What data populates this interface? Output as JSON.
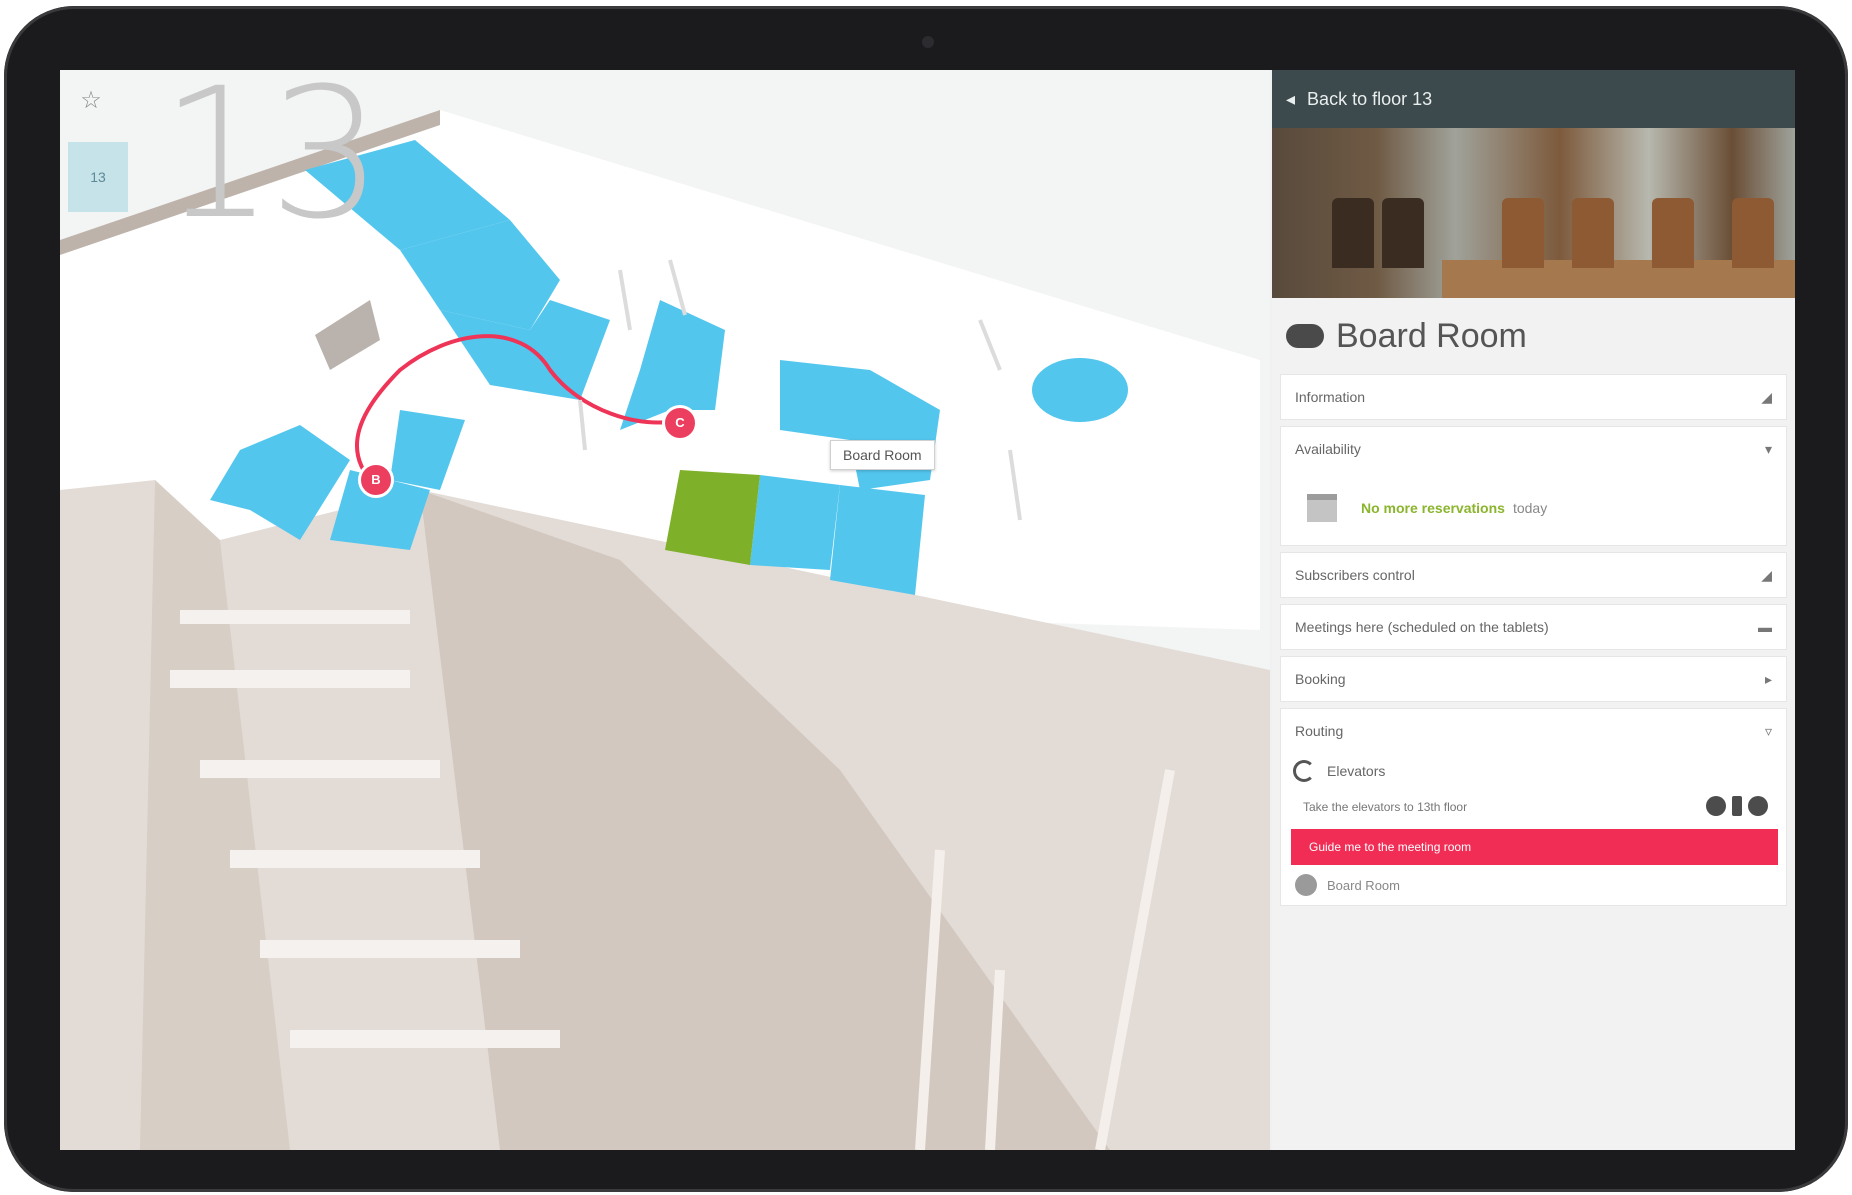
{
  "map": {
    "floor_number": "13",
    "level_button": "13",
    "tooltip": "Board Room",
    "route_start_pin": "B",
    "route_end_pin": "C"
  },
  "panel": {
    "header_back_label": "Back to floor 13",
    "room_name": "Board Room",
    "sections": {
      "information": "Information",
      "availability": "Availability",
      "availability_status": "No more reservations",
      "availability_when": "today",
      "subscribers": "Subscribers control",
      "meetings": "Meetings here (scheduled on the tablets)",
      "booking": "Booking",
      "routing": "Routing"
    },
    "routing": {
      "start_label": "Elevators",
      "transport_label": "Take the elevators to 13th floor",
      "go_button": "Guide me to the meeting room",
      "destination": "Board Room"
    }
  },
  "colors": {
    "accent": "#f12d55",
    "room_highlight": "#7fb02a",
    "rooms": "#4fc3ec",
    "header_bg": "#3c4a4d"
  },
  "icons": [
    "star-icon",
    "back-arrow-icon",
    "cloud-icon",
    "calendar-icon",
    "elevator-icon",
    "pin-icon"
  ]
}
